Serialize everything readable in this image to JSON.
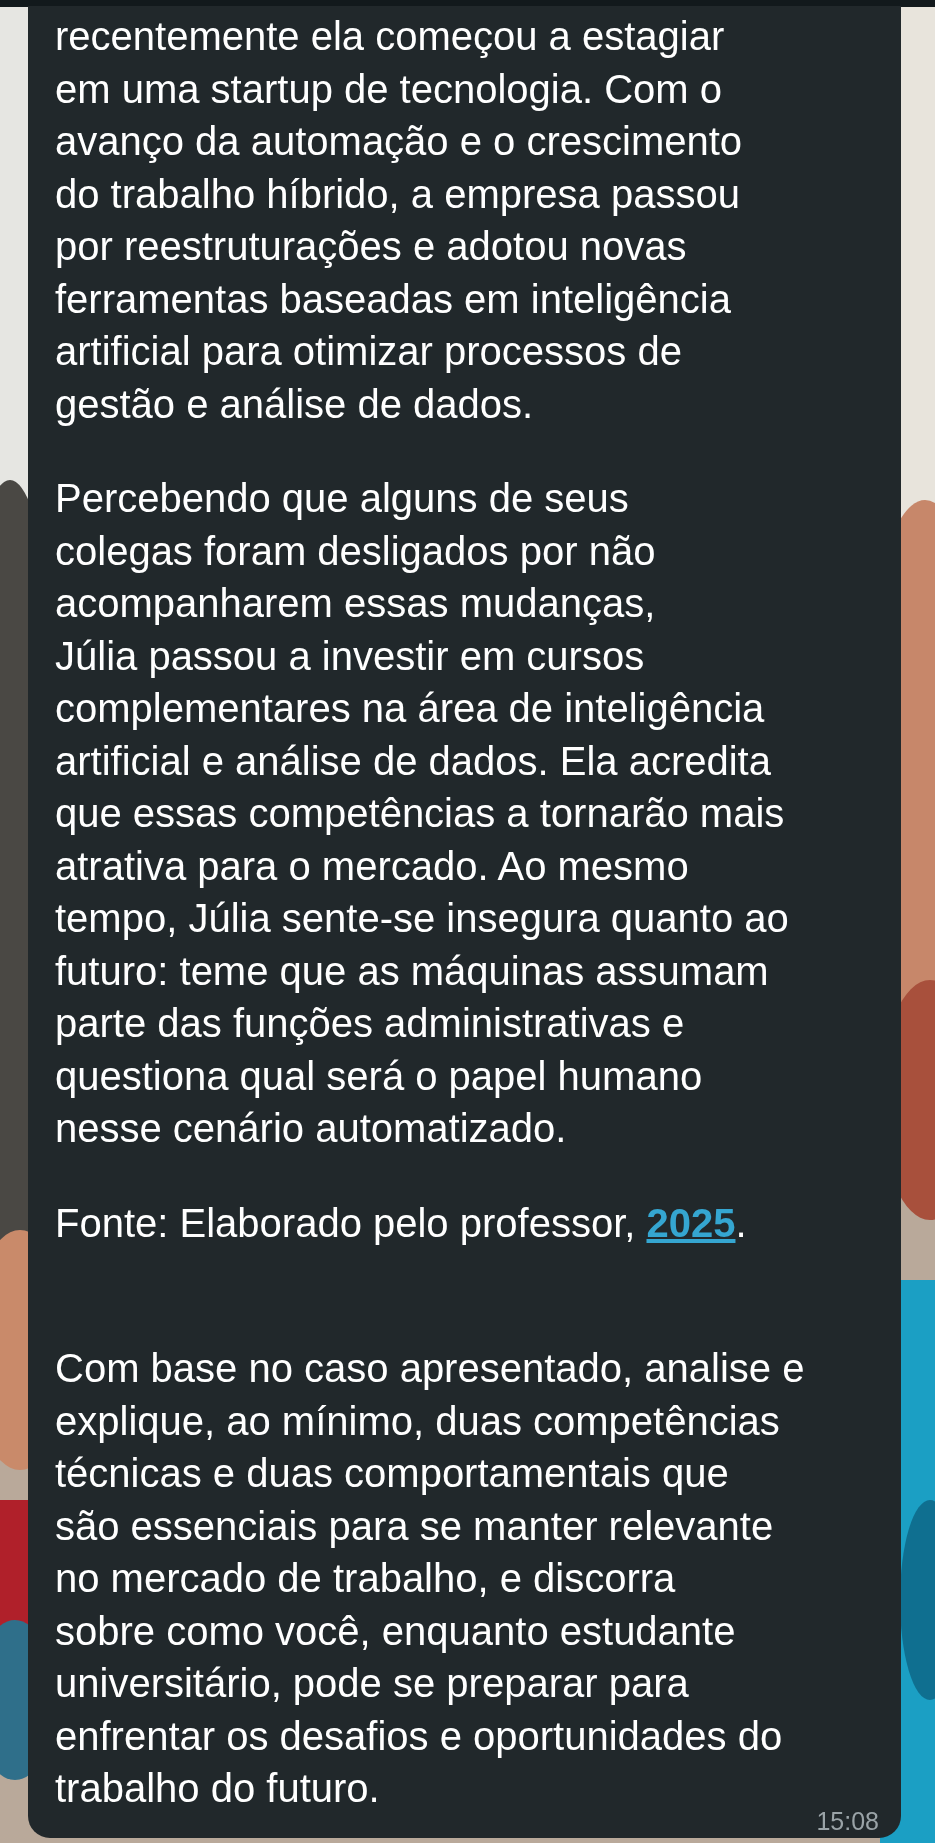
{
  "message": {
    "paragraphs": [
      "recentemente ela começou a estagiar\nem uma startup de tecnologia. Com o\navanço da automação e o crescimento\ndo trabalho híbrido, a empresa passou\npor reestruturações e adotou novas\nferramentas baseadas em inteligência\nartificial para otimizar processos de\ngestão e análise de dados.",
      "Percebendo que alguns de seus\ncolegas foram desligados por não\nacompanharem essas mudanças,\nJúlia passou a investir em cursos\ncomplementares na área de inteligência\nartificial e análise de dados. Ela acredita\nque essas competências a tornarão mais\natrativa para o mercado. Ao mesmo\ntempo, Júlia sente-se insegura quanto ao\nfuturo: teme que as máquinas assumam\nparte das funções administrativas e\nquestiona qual será o papel humano\nnesse cenário automatizado."
    ],
    "source": {
      "text": "Fonte: Elaborado pelo professor, ",
      "link": "2025",
      "suffix": "."
    },
    "question": "Com base no caso apresentado, analise e\nexplique, ao mínimo, duas competências\ntécnicas e duas comportamentais que\nsão essenciais para se manter relevante\nno mercado de trabalho, e discorra\nsobre como você, enquanto estudante\nuniversitário, pode se preparar para\nenfrentar os desafios e oportunidades do\ntrabalho do futuro.",
    "time": "15:08"
  }
}
